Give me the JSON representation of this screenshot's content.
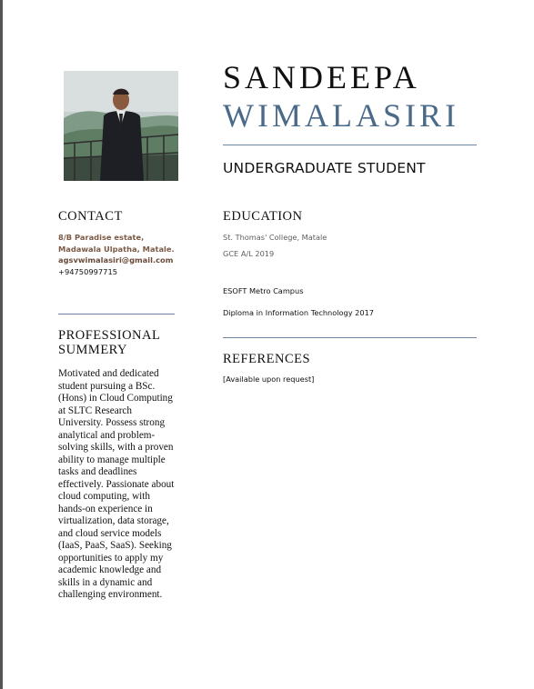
{
  "header": {
    "first_name": "SANDEEPA",
    "last_name": "WIMALASIRI",
    "role": "UNDERGRADUATE STUDENT"
  },
  "contact": {
    "heading": "CONTACT",
    "address_line1": "8/B Paradise estate,",
    "address_line2": "Madawala Ulpatha, Matale.",
    "email": "agsvwimalasiri@gmail.com",
    "phone": "+94750997715"
  },
  "summary": {
    "heading_line1": "PROFESSIONAL",
    "heading_line2": "SUMMERY",
    "lines": [
      "Motivated and dedicated",
      "student pursuing a BSc.",
      "(Hons) in Cloud Computing",
      "at SLTC Research",
      "University. Possess strong",
      "analytical and problem-",
      "solving skills, with a proven",
      "ability to manage multiple",
      "tasks and deadlines",
      "effectively. Passionate about",
      "cloud computing, with",
      "hands-on experience in",
      "virtualization, data storage,",
      "and cloud service models",
      "(IaaS, PaaS, SaaS). Seeking",
      "opportunities to apply my",
      "academic knowledge and",
      "skills in a dynamic and",
      "challenging environment."
    ]
  },
  "education": {
    "heading": "EDUCATION",
    "school": "St. Thomas' College, Matale",
    "school_qualification": "GCE A/L 2019",
    "campus": "ESOFT Metro Campus",
    "campus_qualification": "Diploma in Information Technology 2017"
  },
  "references": {
    "heading": "REFERENCES",
    "text": "[Available upon request]"
  },
  "colors": {
    "accent": "#4a6a8a",
    "rule": "#6d86a3",
    "address_text": "#7b5a45"
  }
}
